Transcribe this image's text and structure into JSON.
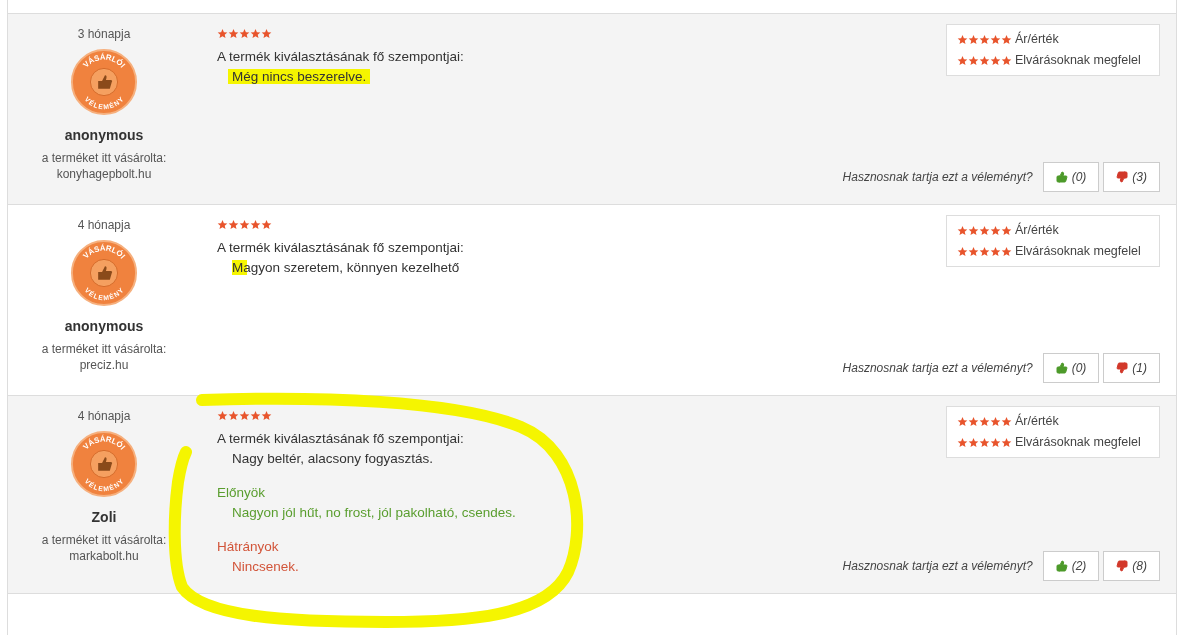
{
  "reviews": [
    {
      "age": "3 hónapja",
      "badge_top": "VÁSÁRLÓI",
      "badge_bottom": "VÉLEMÉNY",
      "author": "anonymous",
      "bought_label": "a terméket itt vásárolta:",
      "shop": "konyhagepbolt.hu",
      "stars": 5,
      "criteria_title": "A termék kiválasztásának fő szempontjai:",
      "criteria": "Még nincs beszerelve.",
      "highlight": {
        "kind": "stroke"
      },
      "ratings": [
        {
          "stars": 5,
          "label": "Ár/érték"
        },
        {
          "stars": 5,
          "label": "Elvárásoknak megfelel"
        }
      ],
      "helpful_question": "Hasznosnak tartja ezt a véleményt?",
      "up": "(0)",
      "down": "(3)"
    },
    {
      "age": "4 hónapja",
      "badge_top": "VÁSÁRLÓI",
      "badge_bottom": "VÉLEMÉNY",
      "author": "anonymous",
      "bought_label": "a terméket itt vásárolta:",
      "shop": "preciz.hu",
      "stars": 5,
      "criteria_title": "A termék kiválasztásának fő szempontjai:",
      "criteria": "Magyon szeretem, könnyen kezelhető",
      "highlight": {
        "kind": "mark"
      },
      "ratings": [
        {
          "stars": 5,
          "label": "Ár/érték"
        },
        {
          "stars": 5,
          "label": "Elvárásoknak megfelel"
        }
      ],
      "helpful_question": "Hasznosnak tartja ezt a véleményt?",
      "up": "(0)",
      "down": "(1)"
    },
    {
      "age": "4 hónapja",
      "badge_top": "VÁSÁRLÓI",
      "badge_bottom": "VÉLEMÉNY",
      "author": "Zoli",
      "bought_label": "a terméket itt vásárolta:",
      "shop": "markabolt.hu",
      "stars": 5,
      "criteria_title": "A termék kiválasztásának fő szempontjai:",
      "criteria": "Nagy beltér, alacsony fogyasztás.",
      "highlight": {
        "kind": "circle"
      },
      "sections": [
        {
          "kind": "pros",
          "title": "Előnyök",
          "text": "Nagyon jól hűt, no frost, jól pakolható, csendes."
        },
        {
          "kind": "cons",
          "title": "Hátrányok",
          "text": "Nincsenek."
        }
      ],
      "ratings": [
        {
          "stars": 5,
          "label": "Ár/érték"
        },
        {
          "stars": 5,
          "label": "Elvárásoknak megfelel"
        }
      ],
      "helpful_question": "Hasznosnak tartja ezt a véleményt?",
      "up": "(2)",
      "down": "(8)"
    }
  ]
}
